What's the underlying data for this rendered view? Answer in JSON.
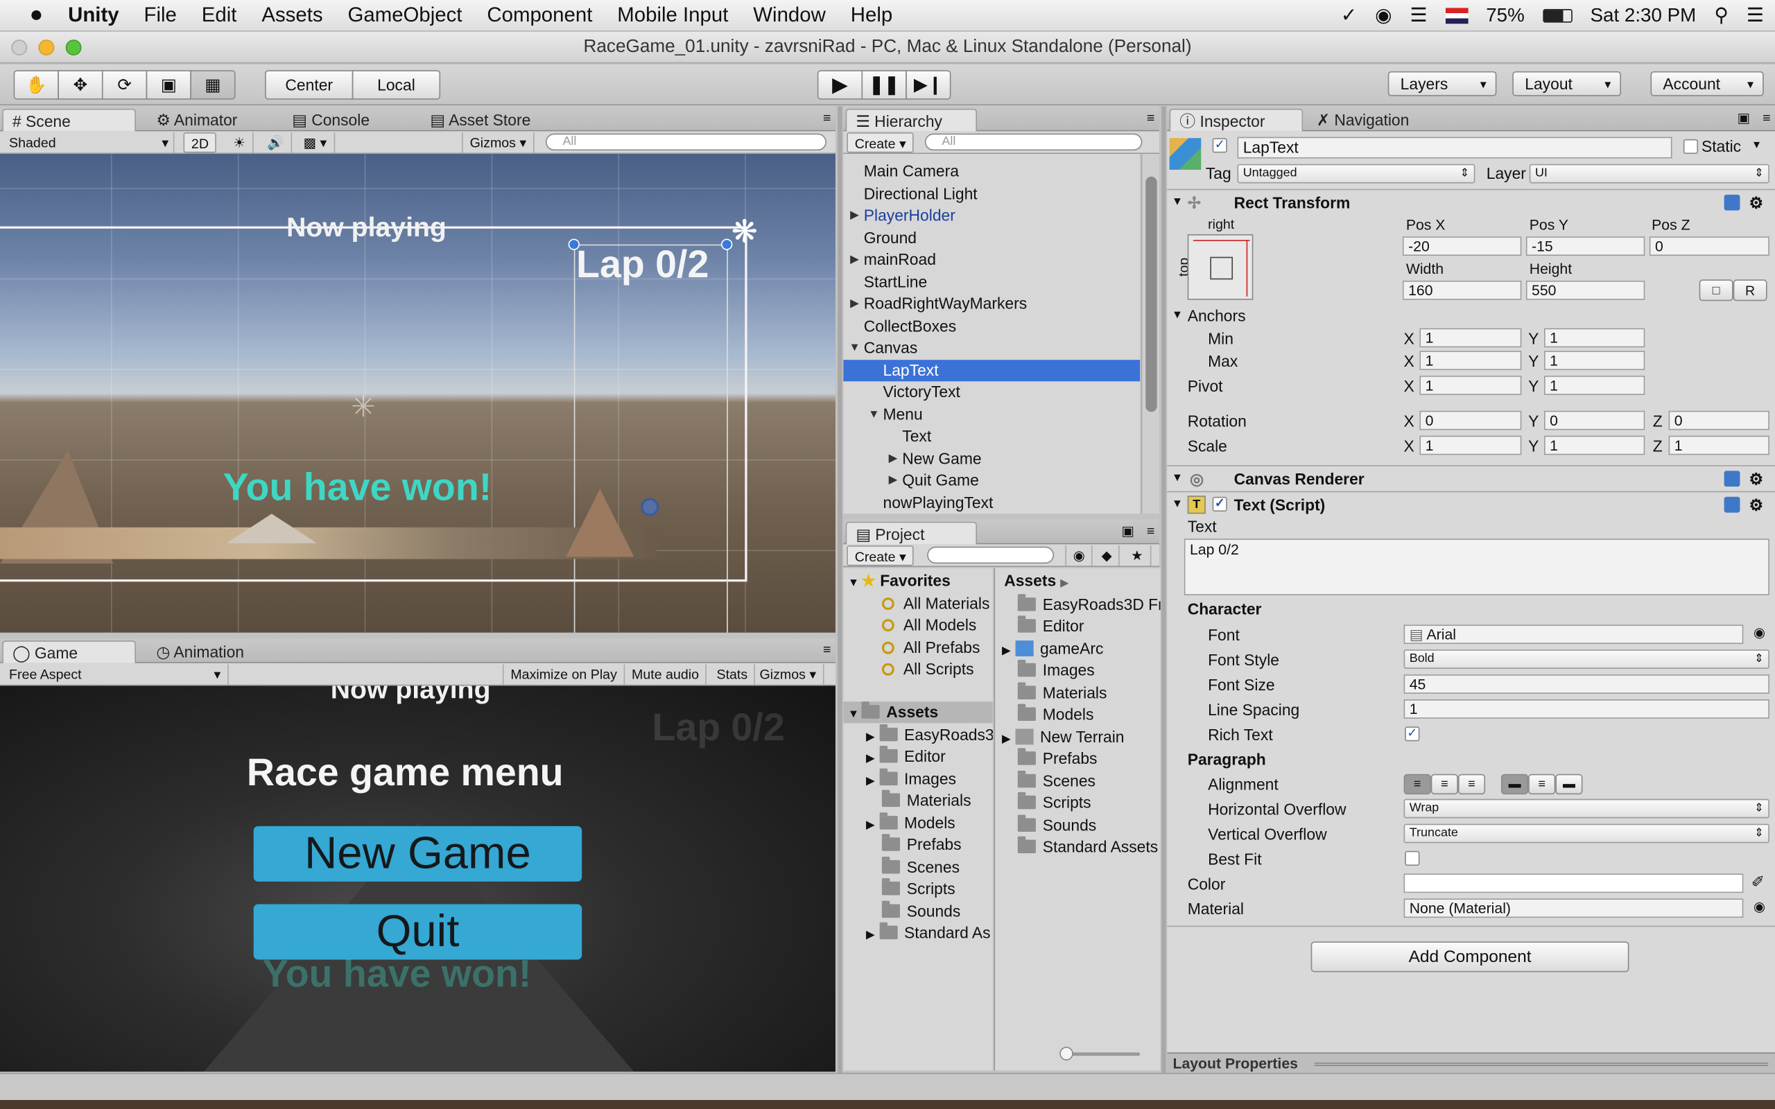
{
  "menubar": {
    "app_name": "Unity",
    "items": [
      "File",
      "Edit",
      "Assets",
      "GameObject",
      "Component",
      "Mobile Input",
      "Window",
      "Help"
    ],
    "battery": "75%",
    "clock": "Sat 2:30 PM"
  },
  "window": {
    "title": "RaceGame_01.unity - zavrsniRad - PC, Mac & Linux Standalone (Personal)"
  },
  "toolbar": {
    "pivot_center": "Center",
    "pivot_local": "Local",
    "layers": "Layers",
    "layout": "Layout",
    "account": "Account"
  },
  "scene_panel": {
    "tabs": [
      "Scene",
      "Animator",
      "Console",
      "Asset Store"
    ],
    "shading": "Shaded",
    "mode_2d": "2D",
    "gizmos": "Gizmos",
    "search_placeholder": "All",
    "now_playing": "Now playing",
    "lap_text": "Lap 0/2",
    "victory_text": "You have won!"
  },
  "game_panel": {
    "tabs": [
      "Game",
      "Animation"
    ],
    "aspect": "Free Aspect",
    "maximize": "Maximize on Play",
    "mute": "Mute audio",
    "stats": "Stats",
    "gizmos": "Gizmos",
    "now_playing": "Now playing",
    "lap_text": "Lap 0/2",
    "menu_title": "Race game menu",
    "new_game": "New Game",
    "quit": "Quit",
    "victory_text": "You have won!"
  },
  "hierarchy": {
    "tab": "Hierarchy",
    "create": "Create",
    "search_placeholder": "All",
    "items": [
      {
        "label": "Main Camera"
      },
      {
        "label": "Directional Light"
      },
      {
        "label": "PlayerHolder"
      },
      {
        "label": "Ground"
      },
      {
        "label": "mainRoad"
      },
      {
        "label": "StartLine"
      },
      {
        "label": "RoadRightWayMarkers"
      },
      {
        "label": "CollectBoxes"
      },
      {
        "label": "Canvas"
      },
      {
        "label": "LapText"
      },
      {
        "label": "VictoryText"
      },
      {
        "label": "Menu"
      },
      {
        "label": "Text"
      },
      {
        "label": "New Game"
      },
      {
        "label": "Quit Game"
      },
      {
        "label": "nowPlayingText"
      }
    ]
  },
  "project": {
    "tab": "Project",
    "create": "Create",
    "favorites_label": "Favorites",
    "favorites": [
      "All Materials",
      "All Models",
      "All Prefabs",
      "All Scripts"
    ],
    "assets_label": "Assets",
    "asset_tree": [
      "EasyRoads3",
      "Editor",
      "Images",
      "Materials",
      "Models",
      "Prefabs",
      "Scenes",
      "Scripts",
      "Sounds",
      "Standard As"
    ],
    "breadcrumb": "Assets",
    "asset_items": [
      "EasyRoads3D Fr",
      "Editor",
      "gameArc",
      "Images",
      "Materials",
      "Models",
      "New Terrain",
      "Prefabs",
      "Scenes",
      "Scripts",
      "Sounds",
      "Standard Assets"
    ]
  },
  "inspector": {
    "tabs": [
      "Inspector",
      "Navigation"
    ],
    "object_name": "LapText",
    "static_label": "Static",
    "tag_label": "Tag",
    "tag_value": "Untagged",
    "layer_label": "Layer",
    "layer_value": "UI",
    "rect_transform": {
      "title": "Rect Transform",
      "anchor_h": "right",
      "anchor_v": "top",
      "pos_x_label": "Pos X",
      "pos_x": "-20",
      "pos_y_label": "Pos Y",
      "pos_y": "-15",
      "pos_z_label": "Pos Z",
      "pos_z": "0",
      "width_label": "Width",
      "width": "160",
      "height_label": "Height",
      "height": "550",
      "r_button": "R",
      "anchors_label": "Anchors",
      "min_label": "Min",
      "min_x": "1",
      "min_y": "1",
      "max_label": "Max",
      "max_x": "1",
      "max_y": "1",
      "pivot_label": "Pivot",
      "pivot_x": "1",
      "pivot_y": "1",
      "rotation_label": "Rotation",
      "rot_x": "0",
      "rot_y": "0",
      "rot_z": "0",
      "scale_label": "Scale",
      "scale_x": "1",
      "scale_y": "1",
      "scale_z": "1",
      "x": "X",
      "y": "Y",
      "z": "Z"
    },
    "canvas_renderer": "Canvas Renderer",
    "text_script": {
      "title": "Text (Script)",
      "text_label": "Text",
      "text_value": "Lap 0/2",
      "character_label": "Character",
      "font_label": "Font",
      "font_value": "Arial",
      "font_style_label": "Font Style",
      "font_style_value": "Bold",
      "font_size_label": "Font Size",
      "font_size_value": "45",
      "line_spacing_label": "Line Spacing",
      "line_spacing_value": "1",
      "rich_text_label": "Rich Text",
      "rich_text": true,
      "paragraph_label": "Paragraph",
      "alignment_label": "Alignment",
      "h_overflow_label": "Horizontal Overflow",
      "h_overflow_value": "Wrap",
      "v_overflow_label": "Vertical Overflow",
      "v_overflow_value": "Truncate",
      "best_fit_label": "Best Fit",
      "best_fit": false,
      "color_label": "Color",
      "material_label": "Material",
      "material_value": "None (Material)"
    },
    "add_component": "Add Component",
    "layout_properties": "Layout Properties"
  },
  "colors": {
    "selection": "#3a72d8",
    "victory_cyan": "#3fd6c4",
    "game_button": "#35a8d4"
  }
}
